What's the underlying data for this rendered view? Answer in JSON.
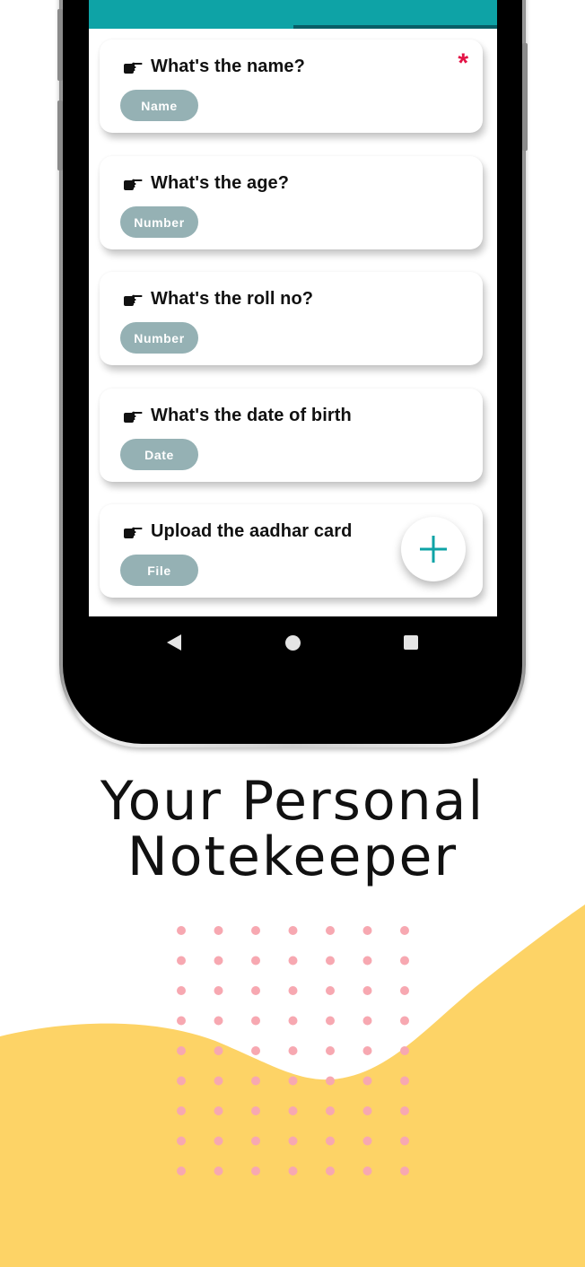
{
  "theme": {
    "app_bar_color": "#0ea3a6",
    "tab_indicator_color": "#075e66",
    "chip_color": "#95b1b4",
    "required_color": "#e31245",
    "fab_icon_color": "#0ea3a6",
    "wave_color": "#fdd366",
    "dot_color": "#f7a8b1"
  },
  "form": {
    "questions": [
      {
        "icon": "hand-pointing-icon",
        "text": "What's the name?",
        "type_label": "Name",
        "required": true,
        "required_marker": "*"
      },
      {
        "icon": "hand-pointing-icon",
        "text": "What's the age?",
        "type_label": "Number",
        "required": false
      },
      {
        "icon": "hand-pointing-icon",
        "text": "What's the roll no?",
        "type_label": "Number",
        "required": false
      },
      {
        "icon": "hand-pointing-icon",
        "text": "What's the date of birth",
        "type_label": "Date",
        "required": false
      },
      {
        "icon": "hand-pointing-icon",
        "text": "Upload the aadhar card",
        "type_label": "File",
        "required": false
      }
    ],
    "fab_icon": "plus-icon"
  },
  "navigation": {
    "icons": [
      "back-icon",
      "home-icon",
      "recents-icon"
    ]
  },
  "headline": {
    "line1": "Your Personal",
    "line2": "Notekeeper"
  }
}
